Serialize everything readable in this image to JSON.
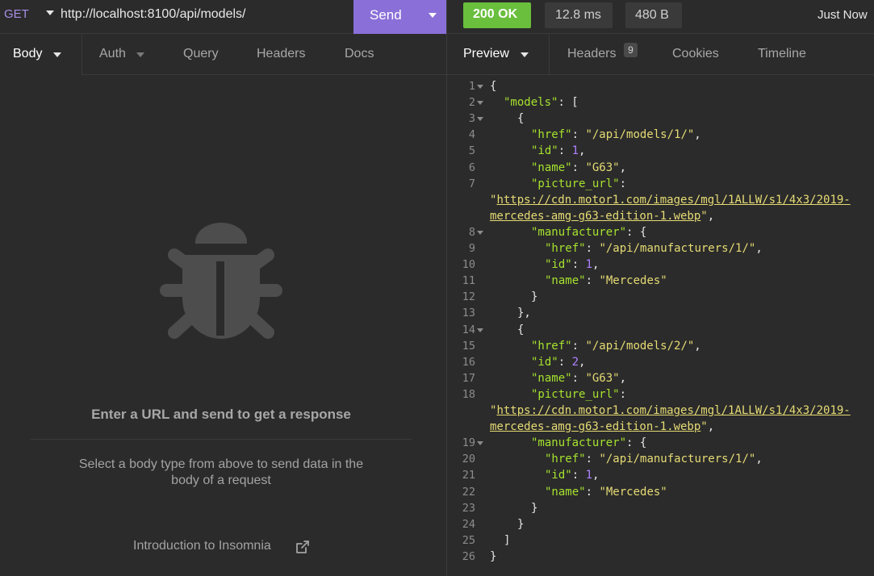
{
  "request": {
    "method": "GET",
    "url": "http://localhost:8100/api/models/",
    "send_label": "Send"
  },
  "response_meta": {
    "status": "200 OK",
    "time": "12.8 ms",
    "size": "480 B",
    "when": "Just Now"
  },
  "colors": {
    "send": "#8a6fd8",
    "status_ok": "#6abf3d",
    "json_key": "#a6e22e",
    "json_string": "#e6db74",
    "json_number": "#ae81ff"
  },
  "left_tabs": [
    "Body",
    "Auth",
    "Query",
    "Headers",
    "Docs"
  ],
  "left_empty": {
    "icon": "bug-icon",
    "title": "Enter a URL and send to get a response",
    "hint": "Select a body type from above to send data in the body of a request",
    "link": "Introduction to Insomnia",
    "link_icon": "external-link-icon"
  },
  "right_tabs": {
    "preview": "Preview",
    "headers": "Headers",
    "headers_count": "9",
    "cookies": "Cookies",
    "timeline": "Timeline"
  },
  "code_lines": [
    {
      "n": "1",
      "fold": true,
      "indent": 0,
      "parts": [
        [
          "p",
          "{"
        ]
      ]
    },
    {
      "n": "2",
      "fold": true,
      "indent": 1,
      "parts": [
        [
          "k",
          "\"models\""
        ],
        [
          "p",
          ": ["
        ]
      ]
    },
    {
      "n": "3",
      "fold": true,
      "indent": 2,
      "parts": [
        [
          "p",
          "{"
        ]
      ]
    },
    {
      "n": "4",
      "indent": 3,
      "parts": [
        [
          "k",
          "\"href\""
        ],
        [
          "p",
          ": "
        ],
        [
          "s",
          "\"/api/models/1/\""
        ],
        [
          "p",
          ","
        ]
      ]
    },
    {
      "n": "5",
      "indent": 3,
      "parts": [
        [
          "k",
          "\"id\""
        ],
        [
          "p",
          ": "
        ],
        [
          "n",
          "1"
        ],
        [
          "p",
          ","
        ]
      ]
    },
    {
      "n": "6",
      "indent": 3,
      "parts": [
        [
          "k",
          "\"name\""
        ],
        [
          "p",
          ": "
        ],
        [
          "s",
          "\"G63\""
        ],
        [
          "p",
          ","
        ]
      ]
    },
    {
      "n": "7",
      "indent": 3,
      "parts": [
        [
          "k",
          "\"picture_url\""
        ],
        [
          "p",
          ":"
        ]
      ]
    },
    {
      "n": "",
      "indent": 0,
      "parts": [
        [
          "s",
          "\""
        ],
        [
          "u",
          "https://cdn.motor1.com/images/mgl/1ALLW/s1/4x3/2019-"
        ]
      ]
    },
    {
      "n": "",
      "indent": 0,
      "parts": [
        [
          "u",
          "mercedes-amg-g63-edition-1.webp"
        ],
        [
          "s",
          "\""
        ],
        [
          "p",
          ","
        ]
      ]
    },
    {
      "n": "8",
      "fold": true,
      "indent": 3,
      "parts": [
        [
          "k",
          "\"manufacturer\""
        ],
        [
          "p",
          ": {"
        ]
      ]
    },
    {
      "n": "9",
      "indent": 4,
      "parts": [
        [
          "k",
          "\"href\""
        ],
        [
          "p",
          ": "
        ],
        [
          "s",
          "\"/api/manufacturers/1/\""
        ],
        [
          "p",
          ","
        ]
      ]
    },
    {
      "n": "10",
      "indent": 4,
      "parts": [
        [
          "k",
          "\"id\""
        ],
        [
          "p",
          ": "
        ],
        [
          "n",
          "1"
        ],
        [
          "p",
          ","
        ]
      ]
    },
    {
      "n": "11",
      "indent": 4,
      "parts": [
        [
          "k",
          "\"name\""
        ],
        [
          "p",
          ": "
        ],
        [
          "s",
          "\"Mercedes\""
        ]
      ]
    },
    {
      "n": "12",
      "indent": 3,
      "parts": [
        [
          "p",
          "}"
        ]
      ]
    },
    {
      "n": "13",
      "indent": 2,
      "parts": [
        [
          "p",
          "},"
        ]
      ]
    },
    {
      "n": "14",
      "fold": true,
      "indent": 2,
      "parts": [
        [
          "p",
          "{"
        ]
      ]
    },
    {
      "n": "15",
      "indent": 3,
      "parts": [
        [
          "k",
          "\"href\""
        ],
        [
          "p",
          ": "
        ],
        [
          "s",
          "\"/api/models/2/\""
        ],
        [
          "p",
          ","
        ]
      ]
    },
    {
      "n": "16",
      "indent": 3,
      "parts": [
        [
          "k",
          "\"id\""
        ],
        [
          "p",
          ": "
        ],
        [
          "n",
          "2"
        ],
        [
          "p",
          ","
        ]
      ]
    },
    {
      "n": "17",
      "indent": 3,
      "parts": [
        [
          "k",
          "\"name\""
        ],
        [
          "p",
          ": "
        ],
        [
          "s",
          "\"G63\""
        ],
        [
          "p",
          ","
        ]
      ]
    },
    {
      "n": "18",
      "indent": 3,
      "parts": [
        [
          "k",
          "\"picture_url\""
        ],
        [
          "p",
          ":"
        ]
      ]
    },
    {
      "n": "",
      "indent": 0,
      "parts": [
        [
          "s",
          "\""
        ],
        [
          "u",
          "https://cdn.motor1.com/images/mgl/1ALLW/s1/4x3/2019-"
        ]
      ]
    },
    {
      "n": "",
      "indent": 0,
      "parts": [
        [
          "u",
          "mercedes-amg-g63-edition-1.webp"
        ],
        [
          "s",
          "\""
        ],
        [
          "p",
          ","
        ]
      ]
    },
    {
      "n": "19",
      "fold": true,
      "indent": 3,
      "parts": [
        [
          "k",
          "\"manufacturer\""
        ],
        [
          "p",
          ": {"
        ]
      ]
    },
    {
      "n": "20",
      "indent": 4,
      "parts": [
        [
          "k",
          "\"href\""
        ],
        [
          "p",
          ": "
        ],
        [
          "s",
          "\"/api/manufacturers/1/\""
        ],
        [
          "p",
          ","
        ]
      ]
    },
    {
      "n": "21",
      "indent": 4,
      "parts": [
        [
          "k",
          "\"id\""
        ],
        [
          "p",
          ": "
        ],
        [
          "n",
          "1"
        ],
        [
          "p",
          ","
        ]
      ]
    },
    {
      "n": "22",
      "indent": 4,
      "parts": [
        [
          "k",
          "\"name\""
        ],
        [
          "p",
          ": "
        ],
        [
          "s",
          "\"Mercedes\""
        ]
      ]
    },
    {
      "n": "23",
      "indent": 3,
      "parts": [
        [
          "p",
          "}"
        ]
      ]
    },
    {
      "n": "24",
      "indent": 2,
      "parts": [
        [
          "p",
          "}"
        ]
      ]
    },
    {
      "n": "25",
      "indent": 1,
      "parts": [
        [
          "p",
          "]"
        ]
      ]
    },
    {
      "n": "26",
      "indent": 0,
      "parts": [
        [
          "p",
          "}"
        ]
      ]
    }
  ]
}
